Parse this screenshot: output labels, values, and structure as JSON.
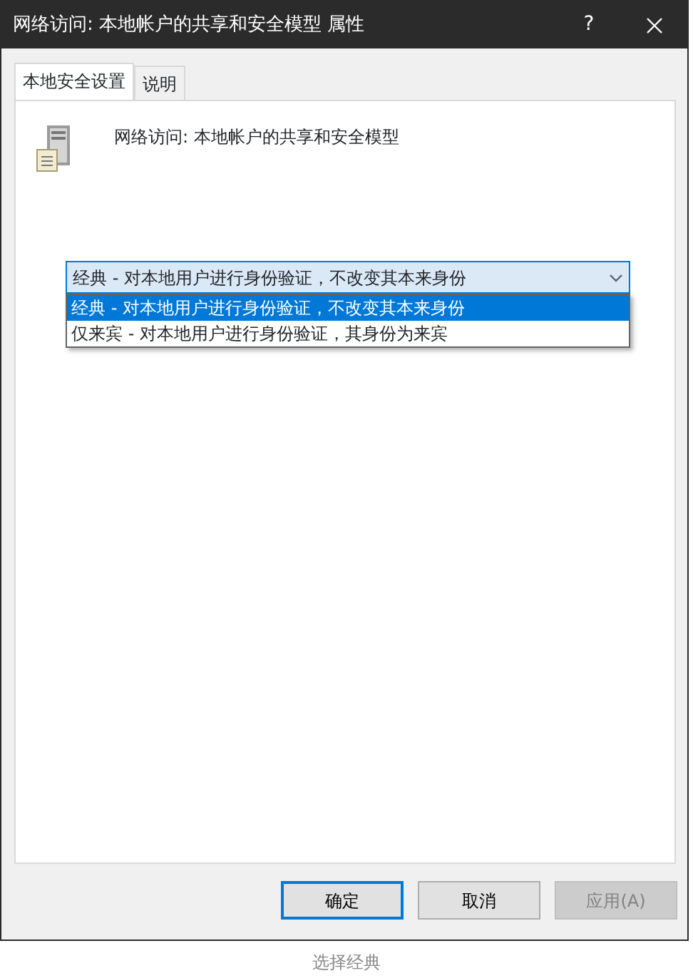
{
  "window": {
    "title": "网络访问: 本地帐户的共享和安全模型 属性",
    "help": "?"
  },
  "tabs": [
    {
      "label": "本地安全设置",
      "selected": true
    },
    {
      "label": "说明",
      "selected": false
    }
  ],
  "policy_title": "网络访问: 本地帐户的共享和安全模型",
  "combo": {
    "value": "经典 - 对本地用户进行身份验证，不改变其本来身份",
    "expanded": true,
    "options": [
      {
        "label": "经典 - 对本地用户进行身份验证，不改变其本来身份",
        "selected": true
      },
      {
        "label": "仅来宾 - 对本地用户进行身份验证，其身份为来宾",
        "selected": false
      }
    ]
  },
  "buttons": [
    {
      "label": "确定",
      "default": true,
      "disabled": false
    },
    {
      "label": "取消",
      "default": false,
      "disabled": false
    },
    {
      "label": "应用(A)",
      "default": false,
      "disabled": true
    }
  ],
  "caption": "选择经典"
}
